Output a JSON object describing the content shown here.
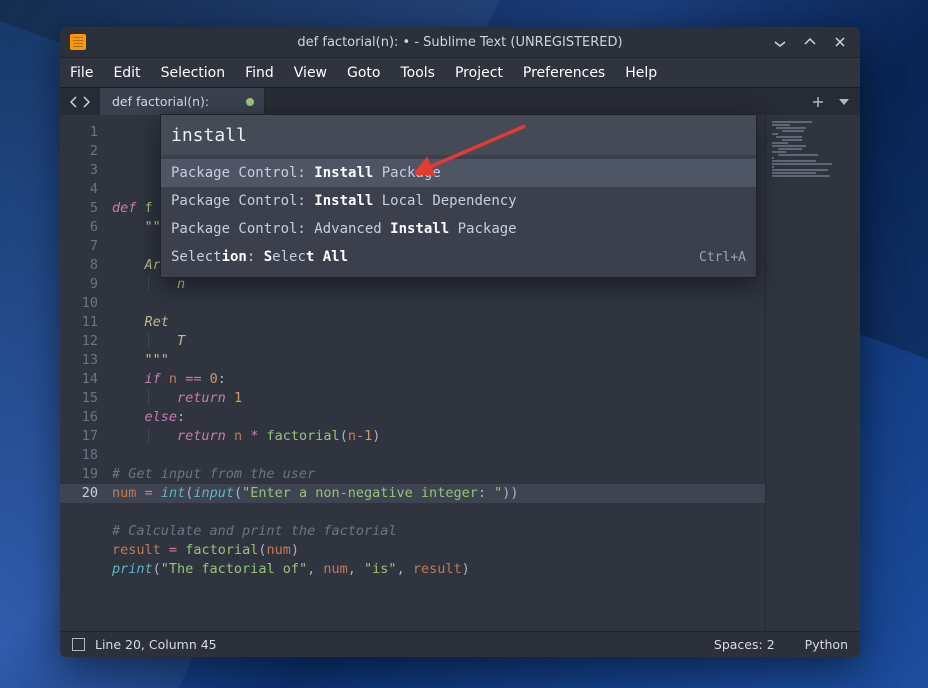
{
  "window": {
    "title": "def factorial(n): • - Sublime Text (UNREGISTERED)"
  },
  "menubar": [
    "File",
    "Edit",
    "Selection",
    "Find",
    "View",
    "Goto",
    "Tools",
    "Project",
    "Preferences",
    "Help"
  ],
  "tabs": [
    {
      "label": "def factorial(n):",
      "dirty": true
    }
  ],
  "palette": {
    "query": "install",
    "results": [
      {
        "pre": "Package Control: ",
        "strong": "Install",
        "post": " Package",
        "shortcut": "",
        "selected": true
      },
      {
        "pre": "Package Control: ",
        "strong": "Install",
        "post": " Local Dependency",
        "shortcut": "",
        "selected": false
      },
      {
        "pre": "Package Control: Advanced ",
        "strong": "Install",
        "post": " Package",
        "shortcut": "",
        "selected": false
      },
      {
        "pre": "Select",
        "strong": "ion",
        "post": ": Select All",
        "shortcut": "Ctrl+A",
        "selected": false,
        "raw_html": "Select<b>ion</b>: <b>S</b>elec<b>t All</b>"
      }
    ]
  },
  "code": {
    "line_count": 20,
    "active_line": 20,
    "lines": [
      {
        "n": 1,
        "html": "<span class='kw'>def</span> <span class='fn'>f</span>"
      },
      {
        "n": 2,
        "html": "    <span class='doc'>\"\"\"</span>"
      },
      {
        "n": 3,
        "html": ""
      },
      {
        "n": 4,
        "html": "    <span class='doc'>Arg</span>"
      },
      {
        "n": 5,
        "html": "    <span class='indent-guide'>│</span>   <span class='doc'>n</span>"
      },
      {
        "n": 6,
        "html": ""
      },
      {
        "n": 7,
        "html": "    <span class='doc'>Ret</span>"
      },
      {
        "n": 8,
        "html": "    <span class='indent-guide'>│</span>   <span class='doc'>T</span>"
      },
      {
        "n": 9,
        "html": "    <span class='doc'>\"\"\"</span>"
      },
      {
        "n": 10,
        "html": "    <span class='kw'>if</span> <span class='var'>n</span> <span class='op'>==</span> <span class='num'>0</span><span class='pn'>:</span>"
      },
      {
        "n": 11,
        "html": "    <span class='indent-guide'>│</span>   <span class='kw'>return</span> <span class='num'>1</span>"
      },
      {
        "n": 12,
        "html": "    <span class='kw'>else</span><span class='pn'>:</span>"
      },
      {
        "n": 13,
        "html": "    <span class='indent-guide'>│</span>   <span class='kw'>return</span> <span class='var'>n</span> <span class='op'>*</span> <span class='fn'>factorial</span><span class='pn'>(</span><span class='var'>n</span><span class='op'>-</span><span class='num'>1</span><span class='pn'>)</span>"
      },
      {
        "n": 14,
        "html": ""
      },
      {
        "n": 15,
        "html": "<span class='cm'># Get input from the user</span>"
      },
      {
        "n": 16,
        "html": "<span class='var'>num</span> <span class='op'>=</span> <span class='bi'>int</span><span class='pn'>(</span><span class='bi'>input</span><span class='pn'>(</span><span class='str'>\"Enter a non-negative integer: \"</span><span class='pn'>))</span>"
      },
      {
        "n": 17,
        "html": ""
      },
      {
        "n": 18,
        "html": "<span class='cm'># Calculate and print the factorial</span>"
      },
      {
        "n": 19,
        "html": "<span class='var'>result</span> <span class='op'>=</span> <span class='fn'>factorial</span><span class='pn'>(</span><span class='var'>num</span><span class='pn'>)</span>"
      },
      {
        "n": 20,
        "html": "<span class='bi'>print</span><span class='pn'>(</span><span class='str'>\"The factorial of\"</span><span class='pn'>,</span> <span class='var'>num</span><span class='pn'>,</span> <span class='str'>\"is\"</span><span class='pn'>,</span> <span class='var'>result</span><span class='pn'>)</span>"
      }
    ]
  },
  "statusbar": {
    "position": "Line 20, Column 45",
    "indentation": "Spaces: 2",
    "syntax": "Python"
  }
}
